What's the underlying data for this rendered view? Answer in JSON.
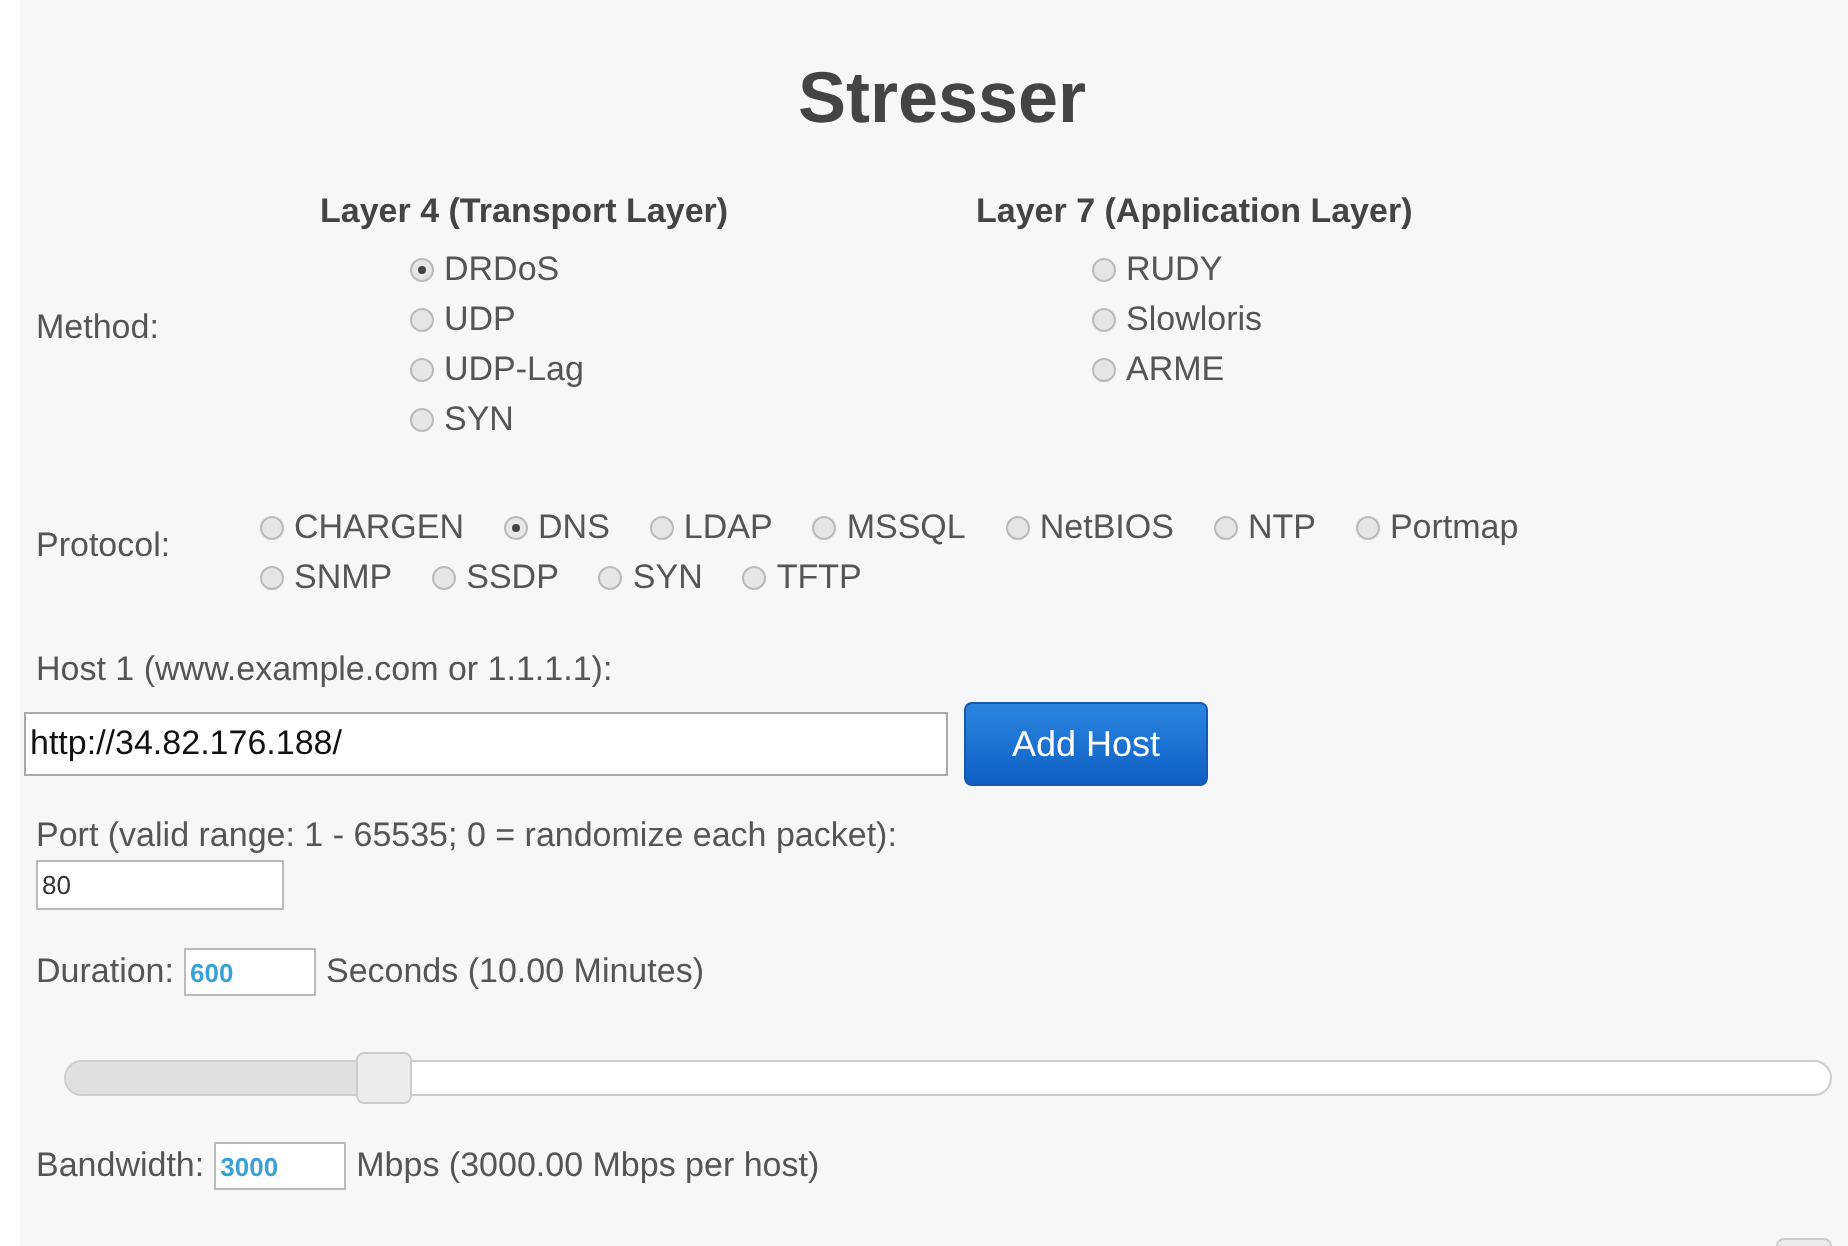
{
  "title": "Stresser",
  "method": {
    "label": "Method:",
    "groups": [
      {
        "heading": "Layer 4 (Transport Layer)",
        "options": [
          {
            "label": "DRDoS",
            "selected": true
          },
          {
            "label": "UDP",
            "selected": false
          },
          {
            "label": "UDP-Lag",
            "selected": false
          },
          {
            "label": "SYN",
            "selected": false
          }
        ]
      },
      {
        "heading": "Layer 7 (Application Layer)",
        "options": [
          {
            "label": "RUDY",
            "selected": false
          },
          {
            "label": "Slowloris",
            "selected": false
          },
          {
            "label": "ARME",
            "selected": false
          }
        ]
      }
    ]
  },
  "protocol": {
    "label": "Protocol:",
    "options": [
      {
        "label": "CHARGEN",
        "selected": false
      },
      {
        "label": "DNS",
        "selected": true
      },
      {
        "label": "LDAP",
        "selected": false
      },
      {
        "label": "MSSQL",
        "selected": false
      },
      {
        "label": "NetBIOS",
        "selected": false
      },
      {
        "label": "NTP",
        "selected": false
      },
      {
        "label": "Portmap",
        "selected": false
      },
      {
        "label": "SNMP",
        "selected": false
      },
      {
        "label": "SSDP",
        "selected": false
      },
      {
        "label": "SYN",
        "selected": false
      },
      {
        "label": "TFTP",
        "selected": false
      }
    ]
  },
  "host": {
    "label": "Host 1 (www.example.com or 1.1.1.1):",
    "value": "http://34.82.176.188/",
    "button": "Add Host"
  },
  "port": {
    "label": "Port (valid range: 1 - 65535; 0 = randomize each packet):",
    "value": "80"
  },
  "duration": {
    "label": "Duration:",
    "value": "600",
    "note": "Seconds (10.00 Minutes)",
    "level": 0.17
  },
  "bandwidth": {
    "label": "Bandwidth:",
    "value": "3000",
    "note": "Mbps (3000.00 Mbps per host)",
    "level": 1.0
  }
}
